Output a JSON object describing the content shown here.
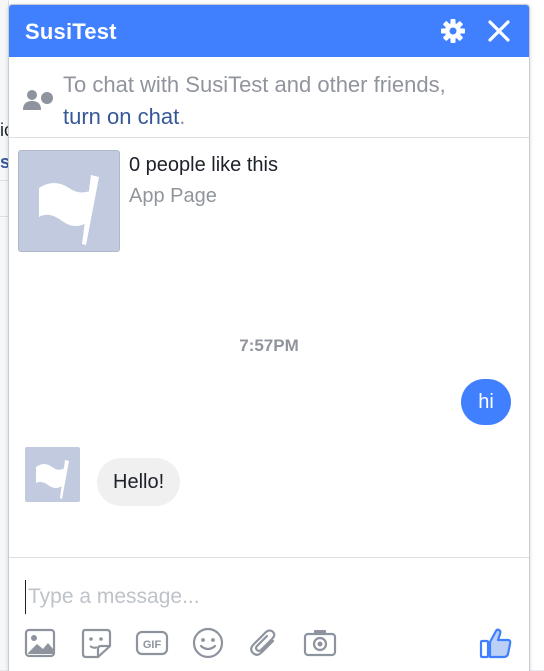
{
  "background": {
    "fragments": [
      "ic",
      "s:"
    ]
  },
  "chat": {
    "title": "SusiTest",
    "header_icons": [
      "gear-icon",
      "close-icon"
    ],
    "notice": {
      "text": "To chat with SusiTest and other friends,",
      "link": "turn on chat",
      "after_link": "."
    },
    "page": {
      "likes": "0 people like this",
      "category": "App Page"
    },
    "timestamp": "7:57PM",
    "messages": [
      {
        "from": "me",
        "text": "hi"
      },
      {
        "from": "page",
        "text": "Hello!"
      }
    ],
    "composer": {
      "placeholder": "Type a message...",
      "value": "",
      "tools": [
        "photo-icon",
        "sticker-icon",
        "gif-icon",
        "emoji-icon",
        "attachment-icon",
        "camera-icon",
        "like-icon"
      ],
      "gif_label": "GIF"
    }
  },
  "colors": {
    "accent": "#4080ff",
    "link": "#365899",
    "muted": "#90949c",
    "incoming_bubble": "#f1f0f0"
  }
}
